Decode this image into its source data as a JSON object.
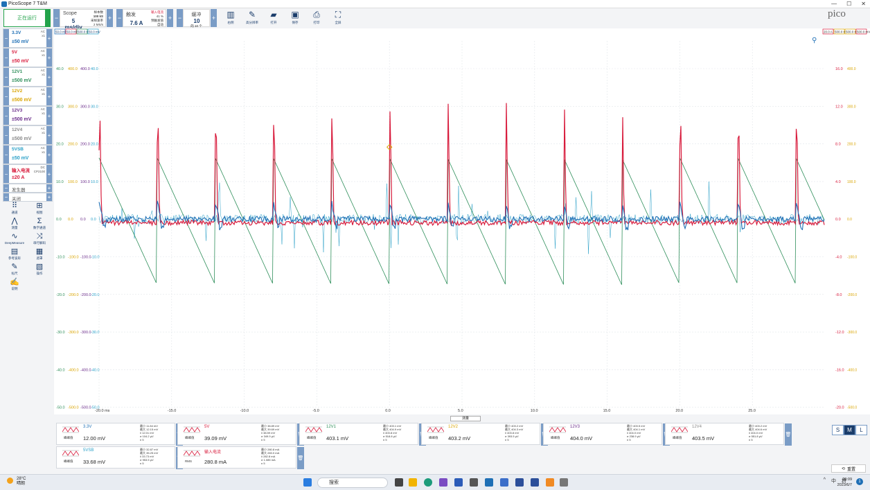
{
  "window": {
    "title": "PicoScope 7 T&M",
    "min": "—",
    "max": "☐",
    "close": "✕"
  },
  "toolbar": {
    "run_label": "正在运行",
    "timebase": {
      "label": "Scope",
      "value": "5 ms/div",
      "side": [
        "样本数",
        "100 kS",
        "采样速率",
        "2 MS/s"
      ]
    },
    "trigger": {
      "label": "触发",
      "value": "7.6 A",
      "side": [
        "输入电流",
        "41 %",
        "预触发值",
        "自动"
      ]
    },
    "captures": {
      "label": "缓冲",
      "value": "10",
      "sub": "的 10 个"
    },
    "tools": [
      {
        "icon": "channels-icon",
        "glyph": "▥",
        "label": "右侧"
      },
      {
        "icon": "probe-icon",
        "glyph": "✎",
        "label": "高分辨率"
      },
      {
        "icon": "open-icon",
        "glyph": "▰",
        "label": "打开"
      },
      {
        "icon": "save-icon",
        "glyph": "▣",
        "label": "保存"
      },
      {
        "icon": "print-icon",
        "glyph": "⎙",
        "label": "打印"
      },
      {
        "icon": "fullscreen-icon",
        "glyph": "⛶",
        "label": "全屏"
      }
    ]
  },
  "channels": [
    {
      "name": "3.3V",
      "range": "±50 mV",
      "coupling": [
        "AC",
        "x1"
      ],
      "color": "#1e6fb5"
    },
    {
      "name": "5V",
      "range": "±50 mV",
      "coupling": [
        "AC",
        "x1"
      ],
      "color": "#d81b3c"
    },
    {
      "name": "12V1",
      "range": "±500 mV",
      "coupling": [
        "AC",
        "x1"
      ],
      "color": "#2f8f5b"
    },
    {
      "name": "12V2",
      "range": "±500 mV",
      "coupling": [
        "AC",
        "x1"
      ],
      "color": "#d9a400"
    },
    {
      "name": "12V3",
      "range": "±500 mV",
      "coupling": [
        "AC",
        "x1"
      ],
      "color": "#6a2c8a"
    },
    {
      "name": "12V4",
      "range": "±500 mV",
      "coupling": [
        "AC",
        "x1"
      ],
      "color": "#888888"
    },
    {
      "name": "5VSB",
      "range": "±50 mV",
      "coupling": [
        "AC",
        "x1"
      ],
      "color": "#2aa0c8"
    },
    {
      "name": "输入电流",
      "range": "±20 A",
      "coupling": [
        "DC",
        "CP2100"
      ],
      "color": "#d81b3c"
    }
  ],
  "small_channels": [
    {
      "name": "发生器"
    },
    {
      "name": "关闭"
    }
  ],
  "side_tools": [
    [
      {
        "glyph": "⠿",
        "label": "通道",
        "icon": "channels-grid-icon"
      },
      {
        "glyph": "⊞",
        "label": "视图",
        "icon": "view-icon"
      }
    ],
    [
      {
        "glyph": "⋀",
        "label": "测量",
        "icon": "measure-icon"
      },
      {
        "glyph": "Σ",
        "label": "数学通道",
        "icon": "math-icon"
      }
    ],
    [
      {
        "glyph": "∿",
        "label": "DeepMeasure",
        "icon": "deepmeasure-icon"
      },
      {
        "glyph": "⤨",
        "label": "串行解码",
        "icon": "serial-decode-icon"
      }
    ],
    [
      {
        "glyph": "▤",
        "label": "参考波形",
        "icon": "reference-icon"
      },
      {
        "glyph": "▦",
        "label": "遮罩",
        "icon": "mask-icon"
      }
    ],
    [
      {
        "glyph": "✎",
        "label": "标尺",
        "icon": "ruler-icon"
      },
      {
        "glyph": "▧",
        "label": "操作",
        "icon": "action-icon"
      }
    ],
    [
      {
        "glyph": "✍",
        "label": "说明",
        "icon": "notes-icon"
      }
    ]
  ],
  "scale_boxes_left": [
    "50.0 mV",
    "50.0 mV",
    "500.0 mV",
    "50.0 mV"
  ],
  "scale_boxes_right": [
    "20.0 A",
    "500.0 mV",
    "500.0 mV",
    "500.0 mV"
  ],
  "plot": {
    "ytick_left": [
      "40.0",
      "30.0",
      "20.0",
      "10.0",
      "0.0",
      "-10.0",
      "-20.0",
      "-30.0",
      "-40.0",
      "-50.0"
    ],
    "ytick_left2": [
      "400.0",
      "300.0",
      "200.0",
      "100.0",
      "0.0",
      "-100.0",
      "-200.0",
      "-300.0",
      "-400.0",
      "-500.0"
    ],
    "ytick_right_a": [
      "16.0",
      "12.0",
      "8.0",
      "4.0",
      "0.0",
      "-4.0",
      "-8.0",
      "-12.0",
      "-16.0",
      "-20.0"
    ],
    "ytick_right_mv": [
      "400.0",
      "300.0",
      "200.0",
      "100.0",
      "0.0",
      "-100.0",
      "-200.0",
      "-300.0",
      "-400.0",
      "-500.0"
    ],
    "xtick": [
      "-20.0 ms",
      "-15.0",
      "-10.0",
      "-5.0",
      "0.0",
      "5.0",
      "10.0",
      "15.0",
      "20.0",
      "25.0"
    ],
    "xlim": [
      -20,
      30
    ],
    "spike_times_ms": [
      -20,
      -16,
      -12,
      -8,
      -4,
      0,
      4,
      8,
      12,
      16,
      20,
      24
    ],
    "current_peak_A": 12.8,
    "current_base_A": -0.4,
    "ramp_start_A": 6.5,
    "ramp_end_A": -7.0
  },
  "measure_tab": "测量",
  "measurements": [
    {
      "name": "3.3V",
      "value": "12.00 mV",
      "kind": "峰峰值",
      "stats": [
        "最小 11.84 mV",
        "最大 12.15 mV",
        "x̄ 12.01 mV",
        "σ 104.2 µV",
        "n 5"
      ],
      "color": "#1e6fb5"
    },
    {
      "name": "5V",
      "value": "39.09 mV",
      "kind": "峰峰值",
      "stats": [
        "最小 38.89 mV",
        "最大 39.69 mV",
        "x̄ 38.59 mV",
        "σ 349.9 µV",
        "n 5"
      ],
      "color": "#d81b3c"
    },
    {
      "name": "12V1",
      "value": "403.1 mV",
      "kind": "峰峰值",
      "stats": [
        "最小 403.1 mV",
        "最大 404.9 mV",
        "x̄ 403.8 mV",
        "σ 518.8 µV",
        "n 5"
      ],
      "color": "#2f8f5b"
    },
    {
      "name": "12V2",
      "value": "403.2 mV",
      "kind": "峰峰值",
      "stats": [
        "最小 403.2 mV",
        "最大 404.3 mV",
        "x̄ 403.8 mV",
        "σ 393.5 µV",
        "n 5"
      ],
      "color": "#d9a400"
    },
    {
      "name": "12V3",
      "value": "404.0 mV",
      "kind": "峰峰值",
      "stats": [
        "最小 403.5 mV",
        "最大 404.1 mV",
        "x̄ 404.0 mV",
        "σ 238.9 µV",
        "n 5"
      ],
      "color": "#6a2c8a"
    },
    {
      "name": "12V4",
      "value": "403.5 mV",
      "kind": "峰峰值",
      "stats": [
        "最小 403.2 mV",
        "最大 404.6 mV",
        "x̄ 404.0 mV",
        "σ 551.8 µV",
        "n 5"
      ],
      "color": "#888888"
    },
    {
      "name": "5VSB",
      "value": "33.68 mV",
      "kind": "峰峰值",
      "stats": [
        "最小 32.87 mV",
        "最大 35.25 mV",
        "x̄ 33.73 mV",
        "σ 953.5 µV",
        "n 5"
      ],
      "color": "#2aa0c8"
    },
    {
      "name": "输入电流",
      "value": "280.8 mA",
      "kind": "RMS",
      "stats": [
        "最小 280.8 mA",
        "最大 283.0 mA",
        "x̄ 282.8 mA",
        "σ 1.085 mA",
        "n 5"
      ],
      "color": "#d81b3c"
    }
  ],
  "size_buttons": [
    "S",
    "M",
    "L"
  ],
  "reset_label": "重置",
  "brand": "pico",
  "taskbar": {
    "temp": "28°C",
    "weather": "晴朗",
    "search": "搜索",
    "time": "20:09",
    "date": "2023/6/7",
    "tray": [
      "^",
      "中",
      "拼"
    ]
  }
}
